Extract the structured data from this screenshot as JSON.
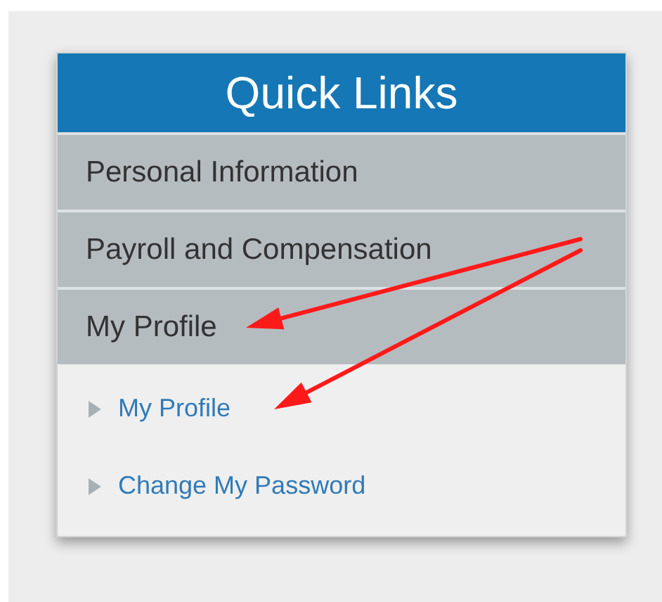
{
  "quick_links": {
    "title": "Quick Links",
    "items": [
      {
        "label": "Personal Information"
      },
      {
        "label": "Payroll and Compensation"
      },
      {
        "label": "My Profile",
        "children": [
          {
            "label": "My Profile"
          },
          {
            "label": "Change My Password"
          }
        ]
      }
    ]
  }
}
